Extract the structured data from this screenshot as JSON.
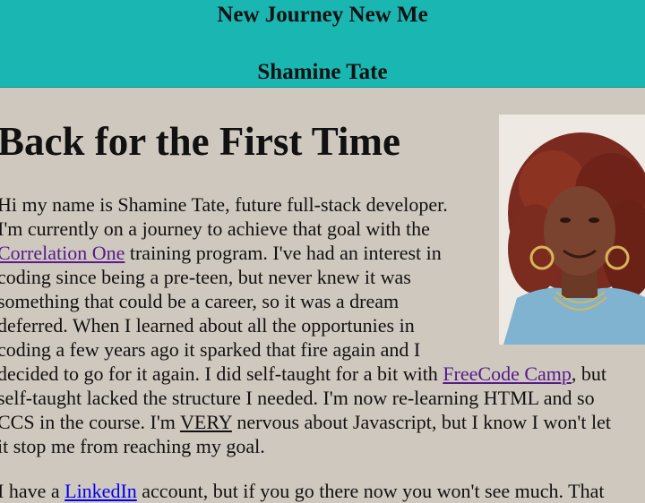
{
  "header": {
    "title": "New Journey New Me",
    "author": "Shamine Tate"
  },
  "main": {
    "heading": "Back for the First Time",
    "photo_alt": "Portrait of Shamine Tate",
    "intro": {
      "l1": "Hi my name is Shamine Tate, future full-stack developer.",
      "l2": "I'm currently on a journey to achieve that goal with the",
      "l3_link": "Correlation One",
      "l3_rest": " training program. I've had an interest in",
      "l4": "coding since being a pre-teen, but never knew it was",
      "l5": "something that could be a career, so it was a dream",
      "l6": "deferred. When I learned about all the opportunies in",
      "l7": "coding a few years ago it sparked that fire again and I",
      "l8_pre": "decided to go for it again. I did self-taught for a bit with ",
      "l8_link": "FreeCode Camp",
      "l8_post": ", but",
      "l9": "self-taught lacked the structure I needed. I'm now re-learning HTML and so",
      "l10_pre": "CCS in the course. I'm ",
      "l10_em": "VERY",
      "l10_post": " nervous about Javascript, but I know I won't let",
      "l11": "it stop me from reaching my goal."
    },
    "second": {
      "pre": "I have a ",
      "link": "LinkedIn",
      "post": " account, but if you go there now you won't see much. That"
    }
  }
}
